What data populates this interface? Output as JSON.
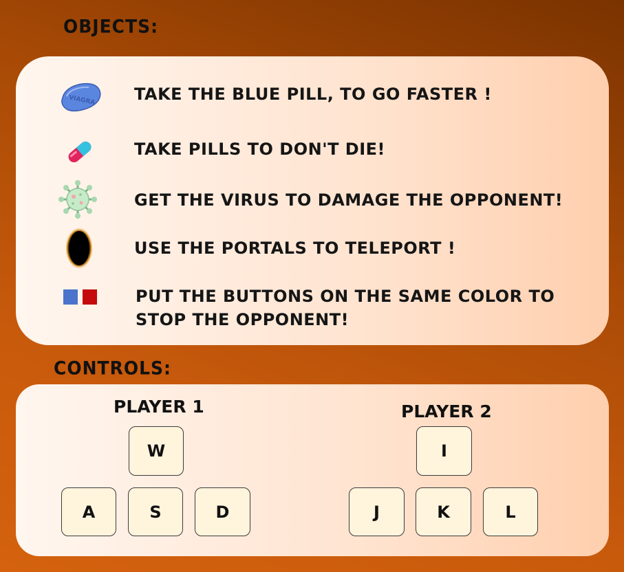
{
  "objects": {
    "heading": "Objects:",
    "items": [
      {
        "icon": "blue-pill-icon",
        "icon_text": "VIAGRA",
        "text": "Take the blue pill, to go faster !"
      },
      {
        "icon": "capsule-pill-icon",
        "text": "Take pills to don't die!"
      },
      {
        "icon": "virus-icon",
        "text": "Get the virus to damage the opponent!"
      },
      {
        "icon": "portal-icon",
        "text": "Use the portals to teleport !"
      },
      {
        "icon": "color-buttons-icon",
        "text": "Put the buttons on the same color to stop the opponent!"
      }
    ]
  },
  "controls": {
    "heading": "Controls:",
    "player1": {
      "label": "Player 1",
      "keys": {
        "up": "W",
        "left": "A",
        "down": "S",
        "right": "D"
      }
    },
    "player2": {
      "label": "Player 2",
      "keys": {
        "up": "I",
        "left": "J",
        "down": "K",
        "right": "L"
      }
    }
  },
  "colors": {
    "background_dark": "#7a3300",
    "background_light": "#d4620e",
    "panel": "#ffe3cf",
    "key_fill": "#fff4dc",
    "blue_button": "#4a74cc",
    "red_button": "#c40a0a"
  }
}
